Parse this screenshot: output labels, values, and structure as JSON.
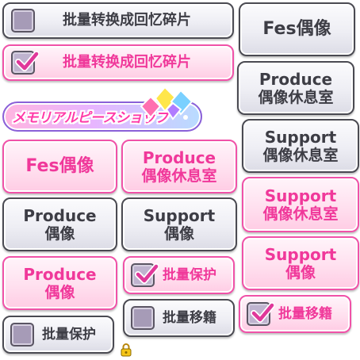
{
  "batch_convert_off": {
    "label": "批量转换成回忆碎片"
  },
  "batch_convert_on": {
    "label": "批量转换成回忆碎片"
  },
  "shop_banner": {
    "label": "メモリアルピースショップ"
  },
  "right_column": {
    "fes_idol": "Fes偶像",
    "produce_lounge_line1": "Produce",
    "produce_lounge_line2": "偶像休息室",
    "support_lounge_line1": "Support",
    "support_lounge_line2": "偶像休息室",
    "support_lounge_pink_line1": "Support",
    "support_lounge_pink_line2": "偶像休息室",
    "support_idol_pink_line1": "Support",
    "support_idol_pink_line2": "偶像"
  },
  "left_grid": {
    "fes_idol_pink": "Fes偶像",
    "produce_lounge_pink_line1": "Produce",
    "produce_lounge_pink_line2": "偶像休息室",
    "produce_idol_gray_line1": "Produce",
    "produce_idol_gray_line2": "偶像",
    "support_idol_gray_line1": "Support",
    "support_idol_gray_line2": "偶像",
    "produce_idol_pink_line1": "Produce",
    "produce_idol_pink_line2": "偶像"
  },
  "batch_protect_on": {
    "label": "批量保护"
  },
  "batch_protect_off": {
    "label": "批量保护"
  },
  "batch_move_off": {
    "label": "批量移籍"
  },
  "batch_move_on": {
    "label": "批量移籍"
  },
  "colors": {
    "pink_border": "#f052a8",
    "pink_text": "#f0389a",
    "gray_border": "#4a4a52",
    "gray_text": "#3d3d45"
  },
  "icons": [
    "checkbox-icon",
    "checkmark-icon",
    "gem-icon",
    "lock-icon"
  ]
}
